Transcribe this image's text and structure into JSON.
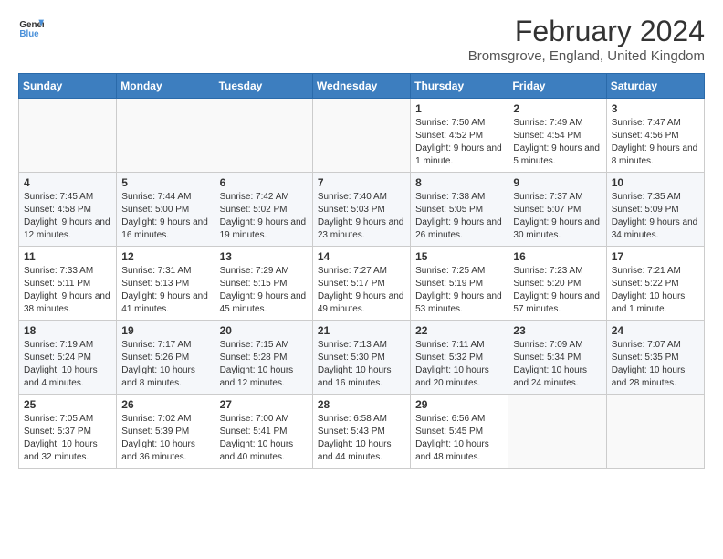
{
  "header": {
    "logo_line1": "General",
    "logo_line2": "Blue",
    "month_title": "February 2024",
    "subtitle": "Bromsgrove, England, United Kingdom"
  },
  "days_of_week": [
    "Sunday",
    "Monday",
    "Tuesday",
    "Wednesday",
    "Thursday",
    "Friday",
    "Saturday"
  ],
  "weeks": [
    [
      {
        "day": "",
        "info": ""
      },
      {
        "day": "",
        "info": ""
      },
      {
        "day": "",
        "info": ""
      },
      {
        "day": "",
        "info": ""
      },
      {
        "day": "1",
        "info": "Sunrise: 7:50 AM\nSunset: 4:52 PM\nDaylight: 9 hours and 1 minute."
      },
      {
        "day": "2",
        "info": "Sunrise: 7:49 AM\nSunset: 4:54 PM\nDaylight: 9 hours and 5 minutes."
      },
      {
        "day": "3",
        "info": "Sunrise: 7:47 AM\nSunset: 4:56 PM\nDaylight: 9 hours and 8 minutes."
      }
    ],
    [
      {
        "day": "4",
        "info": "Sunrise: 7:45 AM\nSunset: 4:58 PM\nDaylight: 9 hours and 12 minutes."
      },
      {
        "day": "5",
        "info": "Sunrise: 7:44 AM\nSunset: 5:00 PM\nDaylight: 9 hours and 16 minutes."
      },
      {
        "day": "6",
        "info": "Sunrise: 7:42 AM\nSunset: 5:02 PM\nDaylight: 9 hours and 19 minutes."
      },
      {
        "day": "7",
        "info": "Sunrise: 7:40 AM\nSunset: 5:03 PM\nDaylight: 9 hours and 23 minutes."
      },
      {
        "day": "8",
        "info": "Sunrise: 7:38 AM\nSunset: 5:05 PM\nDaylight: 9 hours and 26 minutes."
      },
      {
        "day": "9",
        "info": "Sunrise: 7:37 AM\nSunset: 5:07 PM\nDaylight: 9 hours and 30 minutes."
      },
      {
        "day": "10",
        "info": "Sunrise: 7:35 AM\nSunset: 5:09 PM\nDaylight: 9 hours and 34 minutes."
      }
    ],
    [
      {
        "day": "11",
        "info": "Sunrise: 7:33 AM\nSunset: 5:11 PM\nDaylight: 9 hours and 38 minutes."
      },
      {
        "day": "12",
        "info": "Sunrise: 7:31 AM\nSunset: 5:13 PM\nDaylight: 9 hours and 41 minutes."
      },
      {
        "day": "13",
        "info": "Sunrise: 7:29 AM\nSunset: 5:15 PM\nDaylight: 9 hours and 45 minutes."
      },
      {
        "day": "14",
        "info": "Sunrise: 7:27 AM\nSunset: 5:17 PM\nDaylight: 9 hours and 49 minutes."
      },
      {
        "day": "15",
        "info": "Sunrise: 7:25 AM\nSunset: 5:19 PM\nDaylight: 9 hours and 53 minutes."
      },
      {
        "day": "16",
        "info": "Sunrise: 7:23 AM\nSunset: 5:20 PM\nDaylight: 9 hours and 57 minutes."
      },
      {
        "day": "17",
        "info": "Sunrise: 7:21 AM\nSunset: 5:22 PM\nDaylight: 10 hours and 1 minute."
      }
    ],
    [
      {
        "day": "18",
        "info": "Sunrise: 7:19 AM\nSunset: 5:24 PM\nDaylight: 10 hours and 4 minutes."
      },
      {
        "day": "19",
        "info": "Sunrise: 7:17 AM\nSunset: 5:26 PM\nDaylight: 10 hours and 8 minutes."
      },
      {
        "day": "20",
        "info": "Sunrise: 7:15 AM\nSunset: 5:28 PM\nDaylight: 10 hours and 12 minutes."
      },
      {
        "day": "21",
        "info": "Sunrise: 7:13 AM\nSunset: 5:30 PM\nDaylight: 10 hours and 16 minutes."
      },
      {
        "day": "22",
        "info": "Sunrise: 7:11 AM\nSunset: 5:32 PM\nDaylight: 10 hours and 20 minutes."
      },
      {
        "day": "23",
        "info": "Sunrise: 7:09 AM\nSunset: 5:34 PM\nDaylight: 10 hours and 24 minutes."
      },
      {
        "day": "24",
        "info": "Sunrise: 7:07 AM\nSunset: 5:35 PM\nDaylight: 10 hours and 28 minutes."
      }
    ],
    [
      {
        "day": "25",
        "info": "Sunrise: 7:05 AM\nSunset: 5:37 PM\nDaylight: 10 hours and 32 minutes."
      },
      {
        "day": "26",
        "info": "Sunrise: 7:02 AM\nSunset: 5:39 PM\nDaylight: 10 hours and 36 minutes."
      },
      {
        "day": "27",
        "info": "Sunrise: 7:00 AM\nSunset: 5:41 PM\nDaylight: 10 hours and 40 minutes."
      },
      {
        "day": "28",
        "info": "Sunrise: 6:58 AM\nSunset: 5:43 PM\nDaylight: 10 hours and 44 minutes."
      },
      {
        "day": "29",
        "info": "Sunrise: 6:56 AM\nSunset: 5:45 PM\nDaylight: 10 hours and 48 minutes."
      },
      {
        "day": "",
        "info": ""
      },
      {
        "day": "",
        "info": ""
      }
    ]
  ]
}
